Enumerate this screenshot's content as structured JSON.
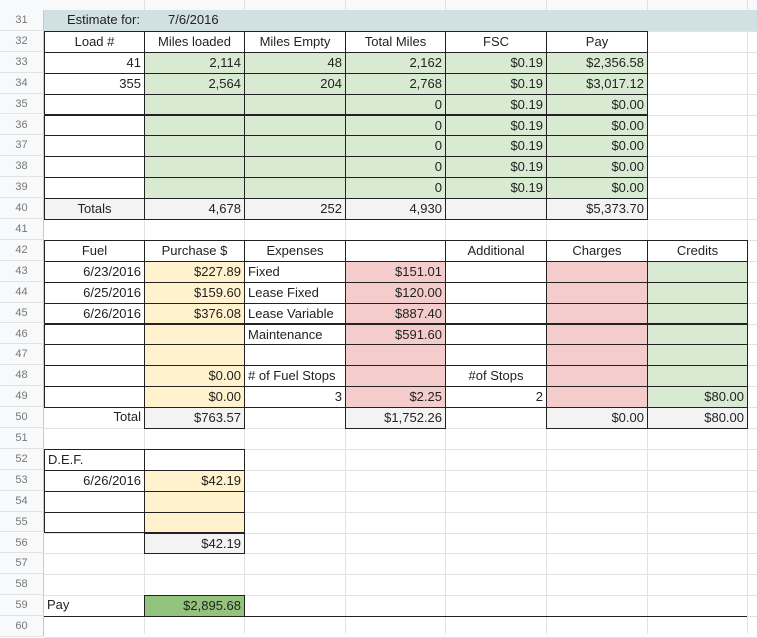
{
  "colors": {
    "green": "#d9ead3",
    "yellow": "#fff2cc",
    "red": "#f4cccc",
    "gray": "#f3f3f3",
    "band": "#d0e0e3",
    "pay": "#93c47d"
  },
  "row_numbers": [
    "31",
    "32",
    "33",
    "34",
    "35",
    "36",
    "37",
    "38",
    "39",
    "40",
    "41",
    "42",
    "43",
    "44",
    "45",
    "46",
    "47",
    "48",
    "49",
    "50",
    "51",
    "52",
    "53",
    "54",
    "55",
    "56",
    "57",
    "58",
    "59",
    "60"
  ],
  "cells": [
    {
      "r": "31",
      "c": "B",
      "v": "Estimate for:",
      "a": "l",
      "bg": "band",
      "name": "estimate-label"
    },
    {
      "r": "31",
      "c": "C",
      "v": "7/6/2016",
      "a": "l",
      "bg": "band",
      "name": "estimate-date"
    },
    {
      "r": "32",
      "c": "B",
      "v": "Load #",
      "a": "c",
      "b": 1,
      "name": "header-load"
    },
    {
      "r": "32",
      "c": "C",
      "v": "Miles loaded",
      "a": "c",
      "b": 1,
      "name": "header-miles-loaded"
    },
    {
      "r": "32",
      "c": "D",
      "v": "Miles Empty",
      "a": "c",
      "b": 1,
      "name": "header-miles-empty"
    },
    {
      "r": "32",
      "c": "E",
      "v": "Total Miles",
      "a": "c",
      "b": 1,
      "name": "header-total-miles"
    },
    {
      "r": "32",
      "c": "F",
      "v": "FSC",
      "a": "c",
      "b": 1,
      "name": "header-fsc"
    },
    {
      "r": "32",
      "c": "G",
      "v": "Pay",
      "a": "c",
      "b": 1,
      "name": "header-pay"
    },
    {
      "r": "33",
      "c": "B",
      "v": "41",
      "a": "r",
      "b": 1
    },
    {
      "r": "33",
      "c": "C",
      "v": "2,114",
      "a": "r",
      "b": 1,
      "bg": "green"
    },
    {
      "r": "33",
      "c": "D",
      "v": "48",
      "a": "r",
      "b": 1,
      "bg": "green"
    },
    {
      "r": "33",
      "c": "E",
      "v": "2,162",
      "a": "r",
      "b": 1,
      "bg": "green"
    },
    {
      "r": "33",
      "c": "F",
      "v": "$0.19",
      "a": "r",
      "b": 1,
      "bg": "green"
    },
    {
      "r": "33",
      "c": "G",
      "v": "$2,356.58",
      "a": "r",
      "b": 1,
      "bg": "green"
    },
    {
      "r": "34",
      "c": "B",
      "v": "355",
      "a": "r",
      "b": 1
    },
    {
      "r": "34",
      "c": "C",
      "v": "2,564",
      "a": "r",
      "b": 1,
      "bg": "green"
    },
    {
      "r": "34",
      "c": "D",
      "v": "204",
      "a": "r",
      "b": 1,
      "bg": "green"
    },
    {
      "r": "34",
      "c": "E",
      "v": "2,768",
      "a": "r",
      "b": 1,
      "bg": "green"
    },
    {
      "r": "34",
      "c": "F",
      "v": "$0.19",
      "a": "r",
      "b": 1,
      "bg": "green"
    },
    {
      "r": "34",
      "c": "G",
      "v": "$3,017.12",
      "a": "r",
      "b": 1,
      "bg": "green"
    },
    {
      "r": "35",
      "c": "B",
      "v": "",
      "b": 1
    },
    {
      "r": "35",
      "c": "C",
      "v": "",
      "b": 1,
      "bg": "green"
    },
    {
      "r": "35",
      "c": "D",
      "v": "",
      "b": 1,
      "bg": "green"
    },
    {
      "r": "35",
      "c": "E",
      "v": "0",
      "a": "r",
      "b": 1,
      "bg": "green"
    },
    {
      "r": "35",
      "c": "F",
      "v": "$0.19",
      "a": "r",
      "b": 1,
      "bg": "green"
    },
    {
      "r": "35",
      "c": "G",
      "v": "$0.00",
      "a": "r",
      "b": 1,
      "bg": "green"
    },
    {
      "r": "36",
      "c": "B",
      "v": "",
      "b": 1
    },
    {
      "r": "36",
      "c": "C",
      "v": "",
      "b": 1,
      "bg": "green"
    },
    {
      "r": "36",
      "c": "D",
      "v": "",
      "b": 1,
      "bg": "green"
    },
    {
      "r": "36",
      "c": "E",
      "v": "0",
      "a": "r",
      "b": 1,
      "bg": "green"
    },
    {
      "r": "36",
      "c": "F",
      "v": "$0.19",
      "a": "r",
      "b": 1,
      "bg": "green"
    },
    {
      "r": "36",
      "c": "G",
      "v": "$0.00",
      "a": "r",
      "b": 1,
      "bg": "green"
    },
    {
      "r": "37",
      "c": "B",
      "v": "",
      "b": 1
    },
    {
      "r": "37",
      "c": "C",
      "v": "",
      "b": 1,
      "bg": "green"
    },
    {
      "r": "37",
      "c": "D",
      "v": "",
      "b": 1,
      "bg": "green"
    },
    {
      "r": "37",
      "c": "E",
      "v": "0",
      "a": "r",
      "b": 1,
      "bg": "green"
    },
    {
      "r": "37",
      "c": "F",
      "v": "$0.19",
      "a": "r",
      "b": 1,
      "bg": "green"
    },
    {
      "r": "37",
      "c": "G",
      "v": "$0.00",
      "a": "r",
      "b": 1,
      "bg": "green"
    },
    {
      "r": "38",
      "c": "B",
      "v": "",
      "b": 1
    },
    {
      "r": "38",
      "c": "C",
      "v": "",
      "b": 1,
      "bg": "green"
    },
    {
      "r": "38",
      "c": "D",
      "v": "",
      "b": 1,
      "bg": "green"
    },
    {
      "r": "38",
      "c": "E",
      "v": "0",
      "a": "r",
      "b": 1,
      "bg": "green"
    },
    {
      "r": "38",
      "c": "F",
      "v": "$0.19",
      "a": "r",
      "b": 1,
      "bg": "green"
    },
    {
      "r": "38",
      "c": "G",
      "v": "$0.00",
      "a": "r",
      "b": 1,
      "bg": "green"
    },
    {
      "r": "39",
      "c": "B",
      "v": "",
      "b": 1
    },
    {
      "r": "39",
      "c": "C",
      "v": "",
      "b": 1,
      "bg": "green"
    },
    {
      "r": "39",
      "c": "D",
      "v": "",
      "b": 1,
      "bg": "green"
    },
    {
      "r": "39",
      "c": "E",
      "v": "0",
      "a": "r",
      "b": 1,
      "bg": "green"
    },
    {
      "r": "39",
      "c": "F",
      "v": "$0.19",
      "a": "r",
      "b": 1,
      "bg": "green"
    },
    {
      "r": "39",
      "c": "G",
      "v": "$0.00",
      "a": "r",
      "b": 1,
      "bg": "green"
    },
    {
      "r": "40",
      "c": "B",
      "v": "Totals",
      "a": "c",
      "b": 1,
      "bg": "gray",
      "name": "totals-label"
    },
    {
      "r": "40",
      "c": "C",
      "v": "4,678",
      "a": "r",
      "b": 1,
      "bg": "gray"
    },
    {
      "r": "40",
      "c": "D",
      "v": "252",
      "a": "r",
      "b": 1,
      "bg": "gray"
    },
    {
      "r": "40",
      "c": "E",
      "v": "4,930",
      "a": "r",
      "b": 1,
      "bg": "gray"
    },
    {
      "r": "40",
      "c": "F",
      "v": "",
      "b": 1,
      "bg": "gray"
    },
    {
      "r": "40",
      "c": "G",
      "v": "$5,373.70",
      "a": "r",
      "b": 1,
      "bg": "gray",
      "name": "total-pay"
    },
    {
      "r": "42",
      "c": "B",
      "v": "Fuel",
      "a": "c",
      "b": 1,
      "name": "header-fuel"
    },
    {
      "r": "42",
      "c": "C",
      "v": "Purchase $",
      "a": "c",
      "b": 1,
      "name": "header-purchase"
    },
    {
      "r": "42",
      "c": "D",
      "v": "Expenses",
      "a": "c",
      "b": 1,
      "name": "header-expenses"
    },
    {
      "r": "42",
      "c": "E",
      "v": "",
      "b": 1
    },
    {
      "r": "42",
      "c": "F",
      "v": "Additional",
      "a": "c",
      "b": 1,
      "name": "header-additional"
    },
    {
      "r": "42",
      "c": "G",
      "v": "Charges",
      "a": "c",
      "b": 1,
      "name": "header-charges"
    },
    {
      "r": "42",
      "c": "H",
      "v": "Credits",
      "a": "c",
      "b": 1,
      "name": "header-credits"
    },
    {
      "r": "43",
      "c": "B",
      "v": "6/23/2016",
      "a": "r",
      "b": 1
    },
    {
      "r": "43",
      "c": "C",
      "v": "$227.89",
      "a": "r",
      "b": 1,
      "bg": "yellow"
    },
    {
      "r": "43",
      "c": "D",
      "v": "Fixed",
      "a": "l",
      "b": 1
    },
    {
      "r": "43",
      "c": "E",
      "v": "$151.01",
      "a": "r",
      "b": 1,
      "bg": "red"
    },
    {
      "r": "43",
      "c": "F",
      "v": "",
      "b": 1
    },
    {
      "r": "43",
      "c": "G",
      "v": "",
      "b": 1,
      "bg": "red"
    },
    {
      "r": "43",
      "c": "H",
      "v": "",
      "b": 1,
      "bg": "green"
    },
    {
      "r": "44",
      "c": "B",
      "v": "6/25/2016",
      "a": "r",
      "b": 1
    },
    {
      "r": "44",
      "c": "C",
      "v": "$159.60",
      "a": "r",
      "b": 1,
      "bg": "yellow"
    },
    {
      "r": "44",
      "c": "D",
      "v": "Lease Fixed",
      "a": "l",
      "b": 1
    },
    {
      "r": "44",
      "c": "E",
      "v": "$120.00",
      "a": "r",
      "b": 1,
      "bg": "red"
    },
    {
      "r": "44",
      "c": "F",
      "v": "",
      "b": 1
    },
    {
      "r": "44",
      "c": "G",
      "v": "",
      "b": 1,
      "bg": "red"
    },
    {
      "r": "44",
      "c": "H",
      "v": "",
      "b": 1,
      "bg": "green"
    },
    {
      "r": "45",
      "c": "B",
      "v": "6/26/2016",
      "a": "r",
      "b": 1
    },
    {
      "r": "45",
      "c": "C",
      "v": "$376.08",
      "a": "r",
      "b": 1,
      "bg": "yellow"
    },
    {
      "r": "45",
      "c": "D",
      "v": "Lease Variable",
      "a": "l",
      "b": 1
    },
    {
      "r": "45",
      "c": "E",
      "v": "$887.40",
      "a": "r",
      "b": 1,
      "bg": "red"
    },
    {
      "r": "45",
      "c": "F",
      "v": "",
      "b": 1
    },
    {
      "r": "45",
      "c": "G",
      "v": "",
      "b": 1,
      "bg": "red"
    },
    {
      "r": "45",
      "c": "H",
      "v": "",
      "b": 1,
      "bg": "green"
    },
    {
      "r": "46",
      "c": "B",
      "v": "",
      "b": 1
    },
    {
      "r": "46",
      "c": "C",
      "v": "",
      "b": 1,
      "bg": "yellow"
    },
    {
      "r": "46",
      "c": "D",
      "v": "Maintenance",
      "a": "l",
      "b": 1
    },
    {
      "r": "46",
      "c": "E",
      "v": "$591.60",
      "a": "r",
      "b": 1,
      "bg": "red"
    },
    {
      "r": "46",
      "c": "F",
      "v": "",
      "b": 1
    },
    {
      "r": "46",
      "c": "G",
      "v": "",
      "b": 1,
      "bg": "red"
    },
    {
      "r": "46",
      "c": "H",
      "v": "",
      "b": 1,
      "bg": "green"
    },
    {
      "r": "47",
      "c": "B",
      "v": "",
      "b": 1
    },
    {
      "r": "47",
      "c": "C",
      "v": "",
      "b": 1,
      "bg": "yellow"
    },
    {
      "r": "47",
      "c": "D",
      "v": "",
      "b": 1
    },
    {
      "r": "47",
      "c": "E",
      "v": "",
      "b": 1,
      "bg": "red"
    },
    {
      "r": "47",
      "c": "F",
      "v": "",
      "b": 1
    },
    {
      "r": "47",
      "c": "G",
      "v": "",
      "b": 1,
      "bg": "red"
    },
    {
      "r": "47",
      "c": "H",
      "v": "",
      "b": 1,
      "bg": "green"
    },
    {
      "r": "48",
      "c": "B",
      "v": "",
      "b": 1
    },
    {
      "r": "48",
      "c": "C",
      "v": "$0.00",
      "a": "r",
      "b": 1,
      "bg": "yellow"
    },
    {
      "r": "48",
      "c": "D",
      "v": "# of Fuel Stops",
      "a": "l",
      "b": 1
    },
    {
      "r": "48",
      "c": "E",
      "v": "",
      "b": 1,
      "bg": "red"
    },
    {
      "r": "48",
      "c": "F",
      "v": "#of Stops",
      "a": "c",
      "b": 1
    },
    {
      "r": "48",
      "c": "G",
      "v": "",
      "b": 1,
      "bg": "red"
    },
    {
      "r": "48",
      "c": "H",
      "v": "",
      "b": 1,
      "bg": "green"
    },
    {
      "r": "49",
      "c": "B",
      "v": "",
      "b": 1
    },
    {
      "r": "49",
      "c": "C",
      "v": "$0.00",
      "a": "r",
      "b": 1,
      "bg": "yellow"
    },
    {
      "r": "49",
      "c": "D",
      "v": "3",
      "a": "r",
      "b": 1
    },
    {
      "r": "49",
      "c": "E",
      "v": "$2.25",
      "a": "r",
      "b": 1,
      "bg": "red"
    },
    {
      "r": "49",
      "c": "F",
      "v": "2",
      "a": "r",
      "b": 1
    },
    {
      "r": "49",
      "c": "G",
      "v": "",
      "b": 1,
      "bg": "red"
    },
    {
      "r": "49",
      "c": "H",
      "v": "$80.00",
      "a": "r",
      "b": 1,
      "bg": "green"
    },
    {
      "r": "50",
      "c": "B",
      "v": "Total",
      "a": "r",
      "name": "fuel-total-label"
    },
    {
      "r": "50",
      "c": "C",
      "v": "$763.57",
      "a": "r",
      "b": 1,
      "bg": "gray",
      "name": "fuel-total"
    },
    {
      "r": "50",
      "c": "E",
      "v": "$1,752.26",
      "a": "r",
      "b": 1,
      "bg": "gray",
      "name": "expenses-total"
    },
    {
      "r": "50",
      "c": "G",
      "v": "$0.00",
      "a": "r",
      "b": 1,
      "bg": "gray",
      "name": "charges-total"
    },
    {
      "r": "50",
      "c": "H",
      "v": "$80.00",
      "a": "r",
      "b": 1,
      "bg": "gray",
      "name": "credits-total"
    },
    {
      "r": "52",
      "c": "B",
      "v": "D.E.F.",
      "a": "l",
      "b": 1,
      "name": "header-def"
    },
    {
      "r": "52",
      "c": "C",
      "v": "",
      "b": 1
    },
    {
      "r": "53",
      "c": "B",
      "v": "6/26/2016",
      "a": "r",
      "b": 1
    },
    {
      "r": "53",
      "c": "C",
      "v": "$42.19",
      "a": "r",
      "b": 1,
      "bg": "yellow"
    },
    {
      "r": "54",
      "c": "B",
      "v": "",
      "b": 1
    },
    {
      "r": "54",
      "c": "C",
      "v": "",
      "b": 1,
      "bg": "yellow"
    },
    {
      "r": "55",
      "c": "B",
      "v": "",
      "b": 1
    },
    {
      "r": "55",
      "c": "C",
      "v": "",
      "b": 1,
      "bg": "yellow"
    },
    {
      "r": "56",
      "c": "C",
      "v": "$42.19",
      "a": "r",
      "b": 1,
      "bg": "gray",
      "name": "def-total"
    },
    {
      "r": "59",
      "c": "A",
      "v": "Pay",
      "a": "l",
      "name": "pay-label"
    },
    {
      "r": "59",
      "c": "C",
      "v": "$2,895.68",
      "a": "r",
      "b": 1,
      "bg": "pay",
      "name": "net-pay"
    }
  ]
}
